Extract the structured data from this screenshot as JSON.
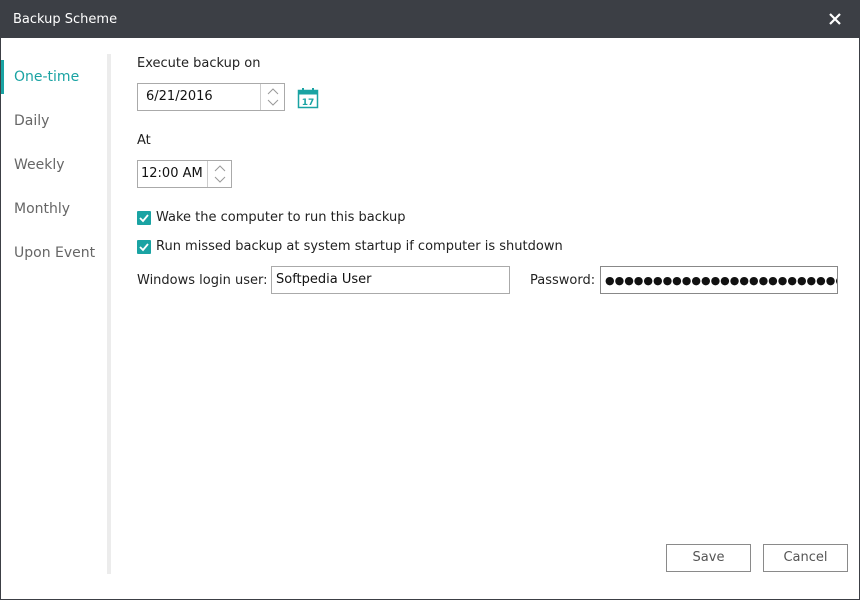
{
  "window": {
    "title": "Backup Scheme",
    "close_icon": "close-icon"
  },
  "sidebar": {
    "items": [
      {
        "label": "One-time",
        "active": true
      },
      {
        "label": "Daily",
        "active": false
      },
      {
        "label": "Weekly",
        "active": false
      },
      {
        "label": "Monthly",
        "active": false
      },
      {
        "label": "Upon Event",
        "active": false
      }
    ]
  },
  "form": {
    "execute_label": "Execute backup on",
    "date_value": "6/21/2016",
    "calendar_icon": "calendar-icon",
    "calendar_day": "17",
    "at_label": "At",
    "time_value": "12:00 AM",
    "wake_label": "Wake the computer to run this backup",
    "wake_checked": true,
    "missed_label": "Run missed backup at system startup if computer is shutdown",
    "missed_checked": true,
    "login_user_label": "Windows login user:",
    "login_user_value": "Softpedia User",
    "password_label": "Password:",
    "password_value": "●●●●●●●●●●●●●●●●●●●●●●●●●"
  },
  "buttons": {
    "save": "Save",
    "cancel": "Cancel"
  },
  "colors": {
    "accent": "#1aa3a3",
    "titlebar": "#3c3f45"
  }
}
